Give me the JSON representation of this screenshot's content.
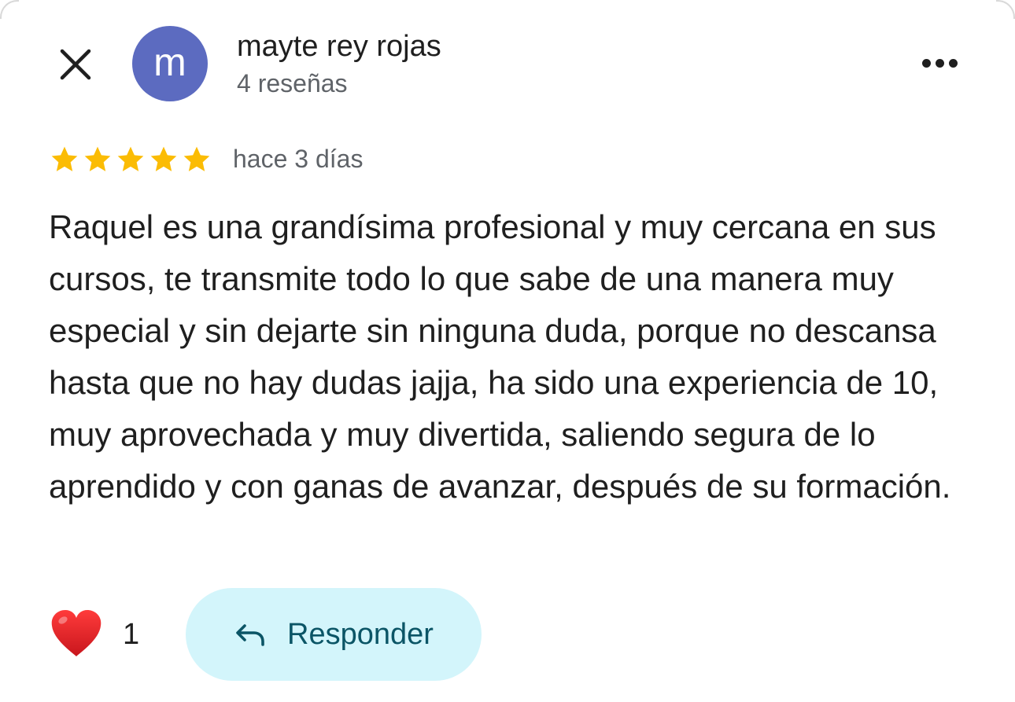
{
  "header": {
    "avatar_letter": "m",
    "avatar_color": "#5c6bc0",
    "author_name": "mayte rey rojas",
    "review_count": "4 reseñas",
    "close_icon": "close-icon",
    "more_icon": "more-horizontal-icon"
  },
  "review": {
    "rating": 5,
    "rating_max": 5,
    "star_color": "#fbbc04",
    "date": "hace 3 días",
    "text": "Raquel es una grandísima profesional y muy cercana en sus cursos, te transmite todo lo que sabe de una manera muy especial y sin dejarte sin ninguna duda, porque no descansa hasta que no hay dudas jajja, ha sido una experiencia de 10, muy aprovechada y muy divertida, saliendo segura de lo aprendido y con ganas de avanzar, después de su formación."
  },
  "actions": {
    "like_icon": "heart-icon",
    "like_count": "1",
    "reply_icon": "reply-arrow-icon",
    "reply_label": "Responder",
    "reply_bg_color": "#d3f5fb",
    "reply_text_color": "#0b5566"
  }
}
